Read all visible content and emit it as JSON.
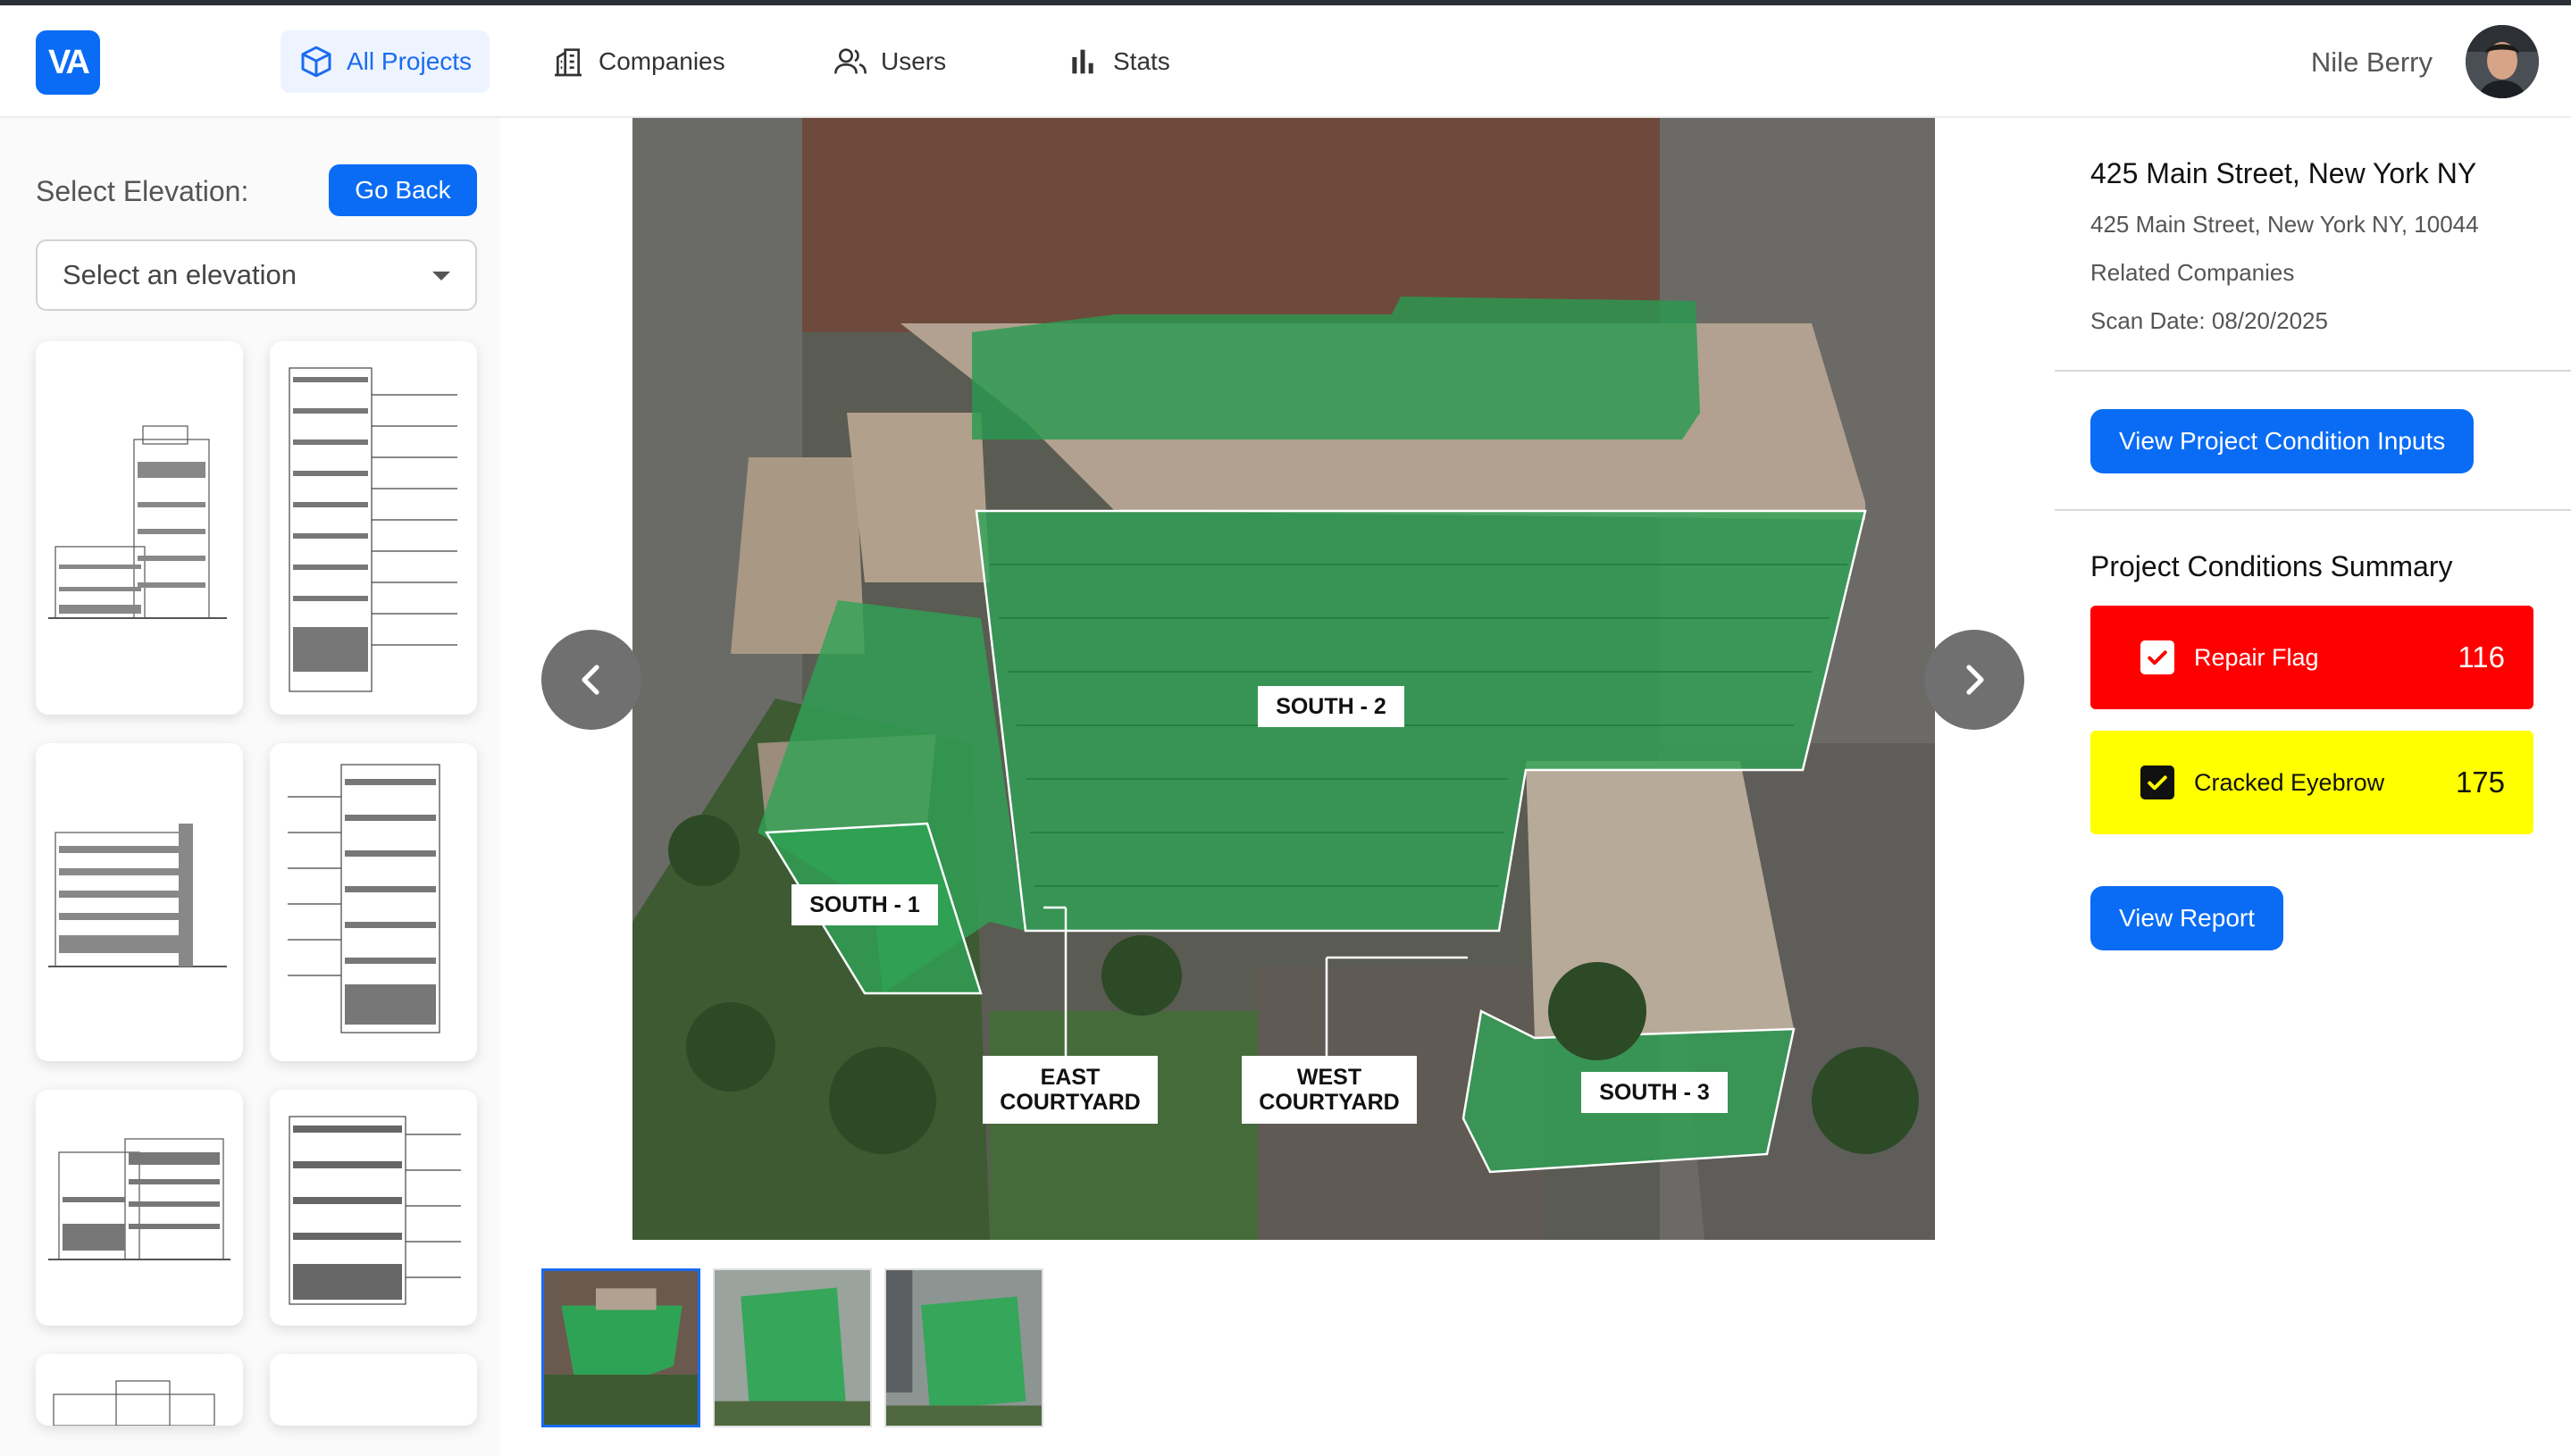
{
  "header": {
    "logo_text": "VA",
    "nav": [
      {
        "label": "All Projects",
        "icon": "cube-icon",
        "active": true
      },
      {
        "label": "Companies",
        "icon": "building-icon",
        "active": false
      },
      {
        "label": "Users",
        "icon": "users-icon",
        "active": false
      },
      {
        "label": "Stats",
        "icon": "bar-chart-icon",
        "active": false
      }
    ],
    "user_name": "Nile Berry"
  },
  "left_panel": {
    "select_label": "Select Elevation:",
    "go_back_label": "Go Back",
    "select_placeholder": "Select an elevation"
  },
  "viewer": {
    "labels": {
      "south1": "SOUTH - 1",
      "south2": "SOUTH - 2",
      "south3": "SOUTH - 3",
      "east_courtyard_1": "EAST",
      "east_courtyard_2": "COURTYARD",
      "west_courtyard_1": "WEST",
      "west_courtyard_2": "COURTYARD"
    }
  },
  "project": {
    "title": "425 Main Street, New York NY",
    "address": "425 Main Street, New York NY, 10044",
    "related": "Related Companies",
    "scan_date": "Scan Date: 08/20/2025",
    "condition_inputs_button": "View Project Condition Inputs",
    "summary_title": "Project Conditions Summary",
    "conditions": [
      {
        "name": "Repair Flag",
        "count": "116",
        "color": "#ff0000"
      },
      {
        "name": "Cracked Eyebrow",
        "count": "175",
        "color": "#ffff00"
      }
    ],
    "view_report_button": "View Report"
  },
  "colors": {
    "accent": "#0a6cf5",
    "overlay_green": "#1fa85a"
  }
}
